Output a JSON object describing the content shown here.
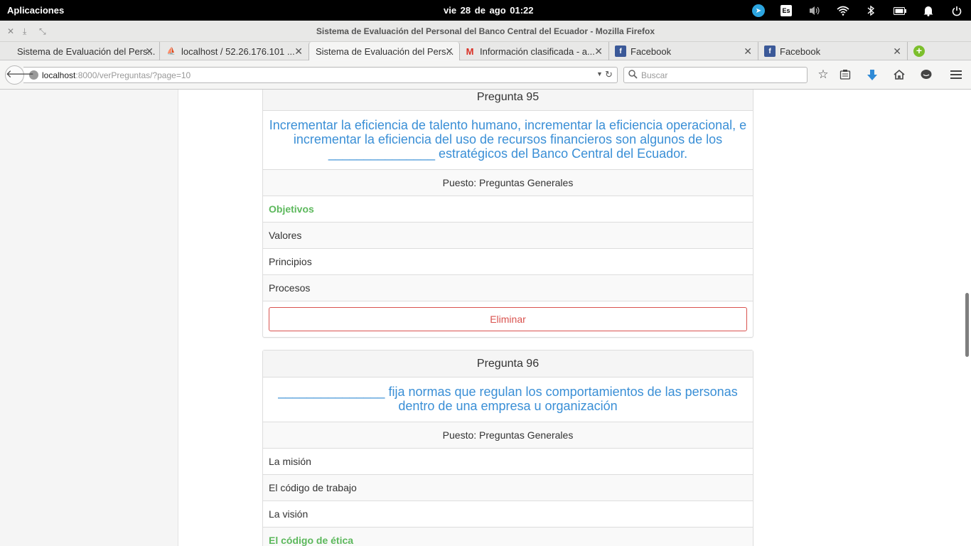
{
  "system": {
    "apps_label": "Aplicaciones",
    "clock": "vie 28 de ago   01:22",
    "keyboard": "Es"
  },
  "window": {
    "title": "Sistema de Evaluación del Personal del Banco Central del Ecuador - Mozilla Firefox"
  },
  "tabs": [
    {
      "label": "Sistema de Evaluación del Pers..."
    },
    {
      "label": "localhost / 52.26.176.101 ..."
    },
    {
      "label": "Sistema de Evaluación del Pers..."
    },
    {
      "label": "Información clasificada - a..."
    },
    {
      "label": "Facebook"
    },
    {
      "label": "Facebook"
    }
  ],
  "navbar": {
    "url_host": "localhost",
    "url_rest": ":8000/verPreguntas/?page=10",
    "search_placeholder": "Buscar"
  },
  "questions": [
    {
      "heading": "Pregunta 95",
      "text": "Incrementar la eficiencia de talento humano, incrementar la eficiencia operacional, e incrementar la eficiencia del uso de recursos financieros son algunos de los _______________ estratégicos del Banco Central del Ecuador.",
      "puesto": "Puesto: Preguntas Generales",
      "answers": [
        "Objetivos",
        "Valores",
        "Principios",
        "Procesos"
      ],
      "correct_index": 0,
      "delete_label": "Eliminar"
    },
    {
      "heading": "Pregunta 96",
      "text": "_______________ fija normas que regulan los comportamientos de las personas dentro de una empresa u organización",
      "puesto": "Puesto: Preguntas Generales",
      "answers": [
        "La misión",
        "El código de trabajo",
        "La visión",
        "El código de ética"
      ],
      "correct_index": 3
    }
  ],
  "colors": {
    "question_text": "#3a8fd6",
    "correct_answer": "#5cb85c",
    "delete_button": "#d9534f"
  }
}
